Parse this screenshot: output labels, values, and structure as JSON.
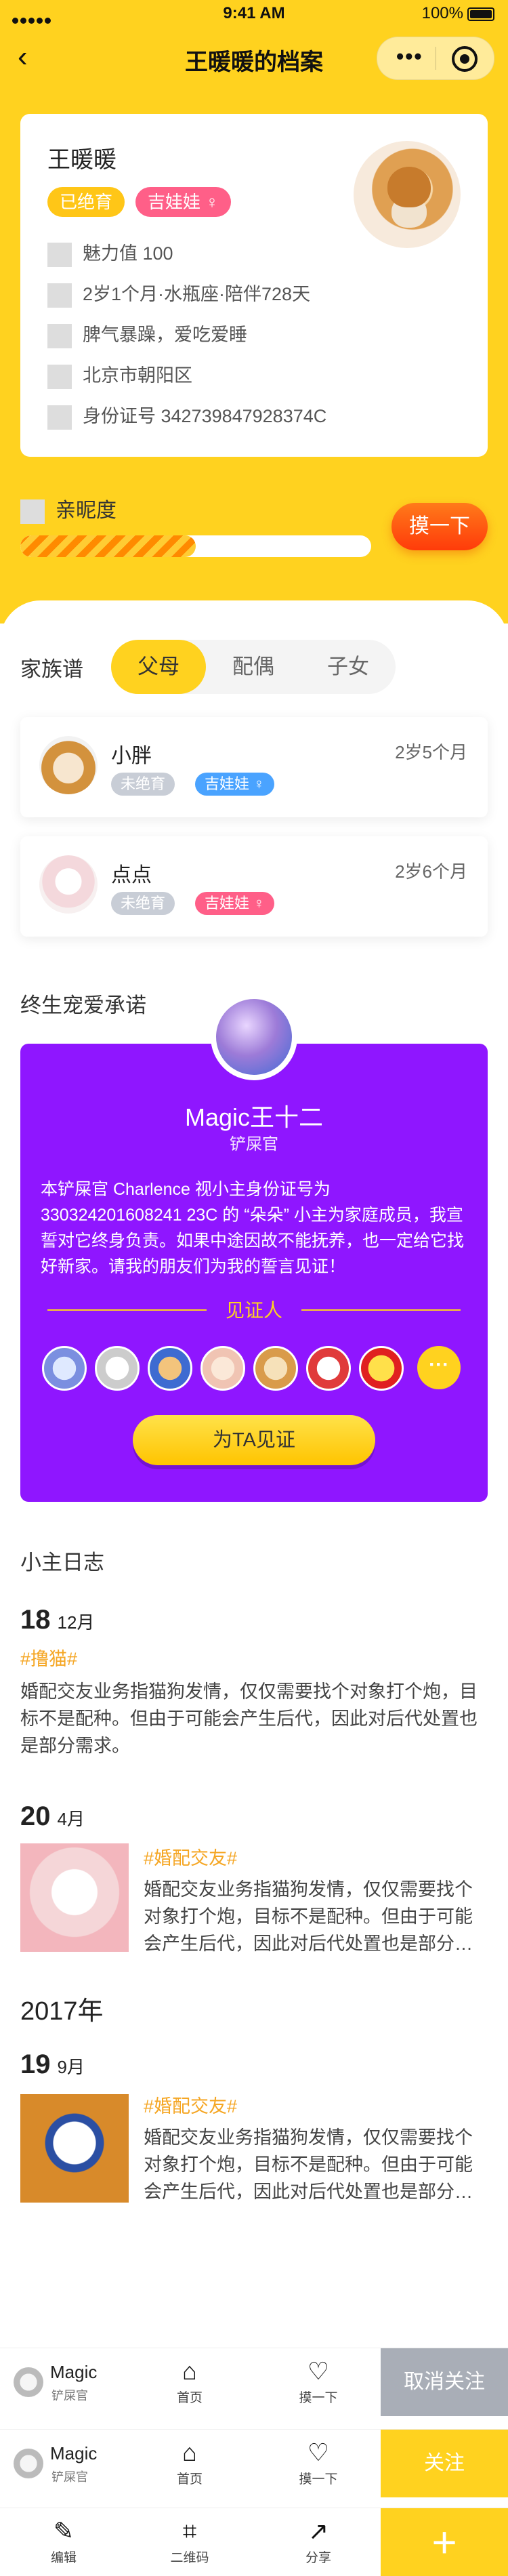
{
  "status_bar": {
    "carrier_dots": "•••••",
    "time": "9:41 AM",
    "battery": "100%"
  },
  "nav": {
    "back_glyph": "‹",
    "title": "王暖暖的档案",
    "more_glyph": "•••"
  },
  "profile": {
    "name": "王暖暖",
    "tags": [
      "已绝育",
      "吉娃娃 ♀"
    ],
    "rows": [
      "魅力值 100",
      "2岁1个月·水瓶座·陪伴728天",
      "脾气暴躁，爱吃爱睡",
      "北京市朝阳区",
      "身份证号 342739847928374C"
    ]
  },
  "intimacy": {
    "label": "亲昵度",
    "level": 0.5,
    "button": "摸一下"
  },
  "family": {
    "label": "家族谱",
    "tabs": [
      "父母",
      "配偶",
      "子女"
    ],
    "active_tab": 0,
    "members": [
      {
        "name": "小胖",
        "age": "2岁5个月",
        "tags": [
          "未绝育",
          "吉娃娃 ♀"
        ]
      },
      {
        "name": "点点",
        "age": "2岁6个月",
        "tags": [
          "未绝育",
          "吉娃娃 ♀"
        ]
      }
    ]
  },
  "pledge": {
    "section_title": "终生宠爱承诺",
    "owner_name": "Magic王十二",
    "owner_role": "铲屎官",
    "text": "本铲屎官 Charlence 视小主身份证号为330324201608241 23C 的 “朵朵” 小主为家庭成员，我宣誓对它终身负责。如果中途因故不能抚养，也一定给它找好新家。请我的朋友们为我的誓言见证！",
    "witness_label": "见证人",
    "more_glyph": "···",
    "button": "为TA见证"
  },
  "diary": {
    "section_title": "小主日志",
    "entries": [
      {
        "day": "18",
        "month": "12月",
        "topic": "#撸猫#",
        "text": "婚配交友业务指猫狗发情，仅仅需要找个对象打个炮，目标不是配种。但由于可能会产生后代，因此对后代处置也是部分需求。"
      },
      {
        "day": "20",
        "month": "4月",
        "topic": "#婚配交友#",
        "text": "婚配交友业务指猫狗发情，仅仅需要找个对象打个炮，目标不是配种。但由于可能会产生后代，因此对后代处置也是部分…"
      },
      {
        "year": "2017年"
      },
      {
        "day": "19",
        "month": "9月",
        "topic": "#婚配交友#",
        "text": "婚配交友业务指猫狗发情，仅仅需要找个对象打个炮，目标不是配种。但由于可能会产生后代，因此对后代处置也是部分…"
      }
    ]
  },
  "bottom_bars": [
    {
      "user": "Magic",
      "role": "铲屎官",
      "home": "首页",
      "touch": "摸一下",
      "action": "取消关注",
      "action_color": "#a9aeb7"
    },
    {
      "user": "Magic",
      "role": "铲屎官",
      "home": "首页",
      "touch": "摸一下",
      "action": "关注",
      "action_color": "#ffd21f"
    }
  ],
  "owner_bar": {
    "edit": "编辑",
    "qrcode": "二维码",
    "share": "分享",
    "add_glyph": "+"
  }
}
